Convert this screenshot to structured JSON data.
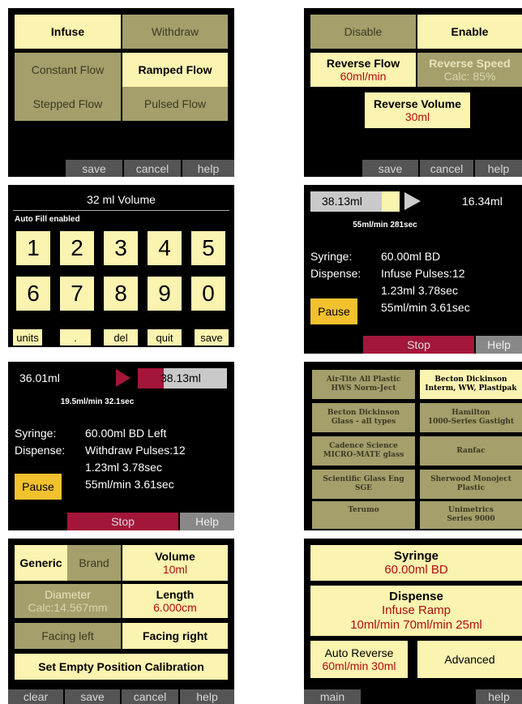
{
  "s1": {
    "infuse": "Infuse",
    "withdraw": "Withdraw",
    "constant": "Constant Flow",
    "ramped": "Ramped Flow",
    "stepped": "Stepped Flow",
    "pulsed": "Pulsed Flow",
    "footer": [
      "save",
      "cancel",
      "help"
    ]
  },
  "s2": {
    "disable": "Disable",
    "enable": "Enable",
    "rev_flow_label": "Reverse Flow",
    "rev_flow_value": "60ml/min",
    "rev_speed_label": "Reverse Speed",
    "rev_speed_value": "Calc: 85%",
    "rev_vol_label": "Reverse Volume",
    "rev_vol_value": "30ml",
    "footer": [
      "save",
      "cancel",
      "help"
    ]
  },
  "s3": {
    "title": "32 ml Volume",
    "subtitle": "Auto Fill enabled",
    "keys": [
      "1",
      "2",
      "3",
      "4",
      "5",
      "6",
      "7",
      "8",
      "9",
      "0"
    ],
    "bottom": [
      "units",
      ".",
      "del",
      "quit",
      "save"
    ]
  },
  "s4": {
    "current": "38.13ml",
    "target": "16.34ml",
    "rate": "55ml/min 281sec",
    "syringe_label": "Syringe:",
    "syringe_value": "60.00ml BD",
    "dispense_label": "Dispense:",
    "dispense_value": "Infuse Pulses:12",
    "line3": "1.23ml 3.78sec",
    "line4": "55ml/min 3.61sec",
    "pause": "Pause",
    "stop": "Stop",
    "help": "Help"
  },
  "s5": {
    "current": "36.01ml",
    "target": "38.13ml",
    "rate": "19.5ml/min 32.1sec",
    "syringe_label": "Syringe:",
    "syringe_value": "60.00ml BD Left",
    "dispense_label": "Dispense:",
    "dispense_value": "Withdraw Pulses:12",
    "line3": "1.23ml 3.78sec",
    "line4": "55ml/min 3.61sec",
    "pause": "Pause",
    "stop": "Stop",
    "help": "Help"
  },
  "s6": {
    "brands": [
      {
        "l1": "Air-Tite All Plastic",
        "l2": "HWS Norm-Ject",
        "on": false
      },
      {
        "l1": "Becton Dickinson",
        "l2": "Interm, WW, Plastipak",
        "on": true
      },
      {
        "l1": "Becton Dickinson",
        "l2": "Glass - all types",
        "on": false
      },
      {
        "l1": "Hamilton",
        "l2": "1000-Series Gastight",
        "on": false
      },
      {
        "l1": "Cadence Science",
        "l2": "MICRO-MATE glass",
        "on": false
      },
      {
        "l1": "Ranfac",
        "l2": "",
        "on": false
      },
      {
        "l1": "Scientific Glass Eng",
        "l2": "SGE",
        "on": false
      },
      {
        "l1": "Sherwood Monoject",
        "l2": "Plastic",
        "on": false
      },
      {
        "l1": "Terumo",
        "l2": "",
        "on": false
      },
      {
        "l1": "Unimetrics",
        "l2": "Series 9000",
        "on": false
      }
    ]
  },
  "s7": {
    "generic": "Generic",
    "brand": "Brand",
    "volume_label": "Volume",
    "volume_value": "10ml",
    "diameter_label": "Diameter",
    "diameter_value": "Calc:14.567mm",
    "length_label": "Length",
    "length_value": "6.000cm",
    "facing_left": "Facing left",
    "facing_right": "Facing right",
    "calibration": "Set Empty Position Calibration",
    "footer": [
      "clear",
      "save",
      "cancel",
      "help"
    ]
  },
  "s8": {
    "syringe_label": "Syringe",
    "syringe_value": "60.00ml BD",
    "dispense_label": "Dispense",
    "dispense_value": "Infuse Ramp",
    "dispense_detail": "10ml/min 70ml/min 25ml",
    "auto_label": "Auto Reverse",
    "auto_value": "60ml/min 30ml",
    "advanced": "Advanced",
    "main": "main",
    "help": "help"
  }
}
